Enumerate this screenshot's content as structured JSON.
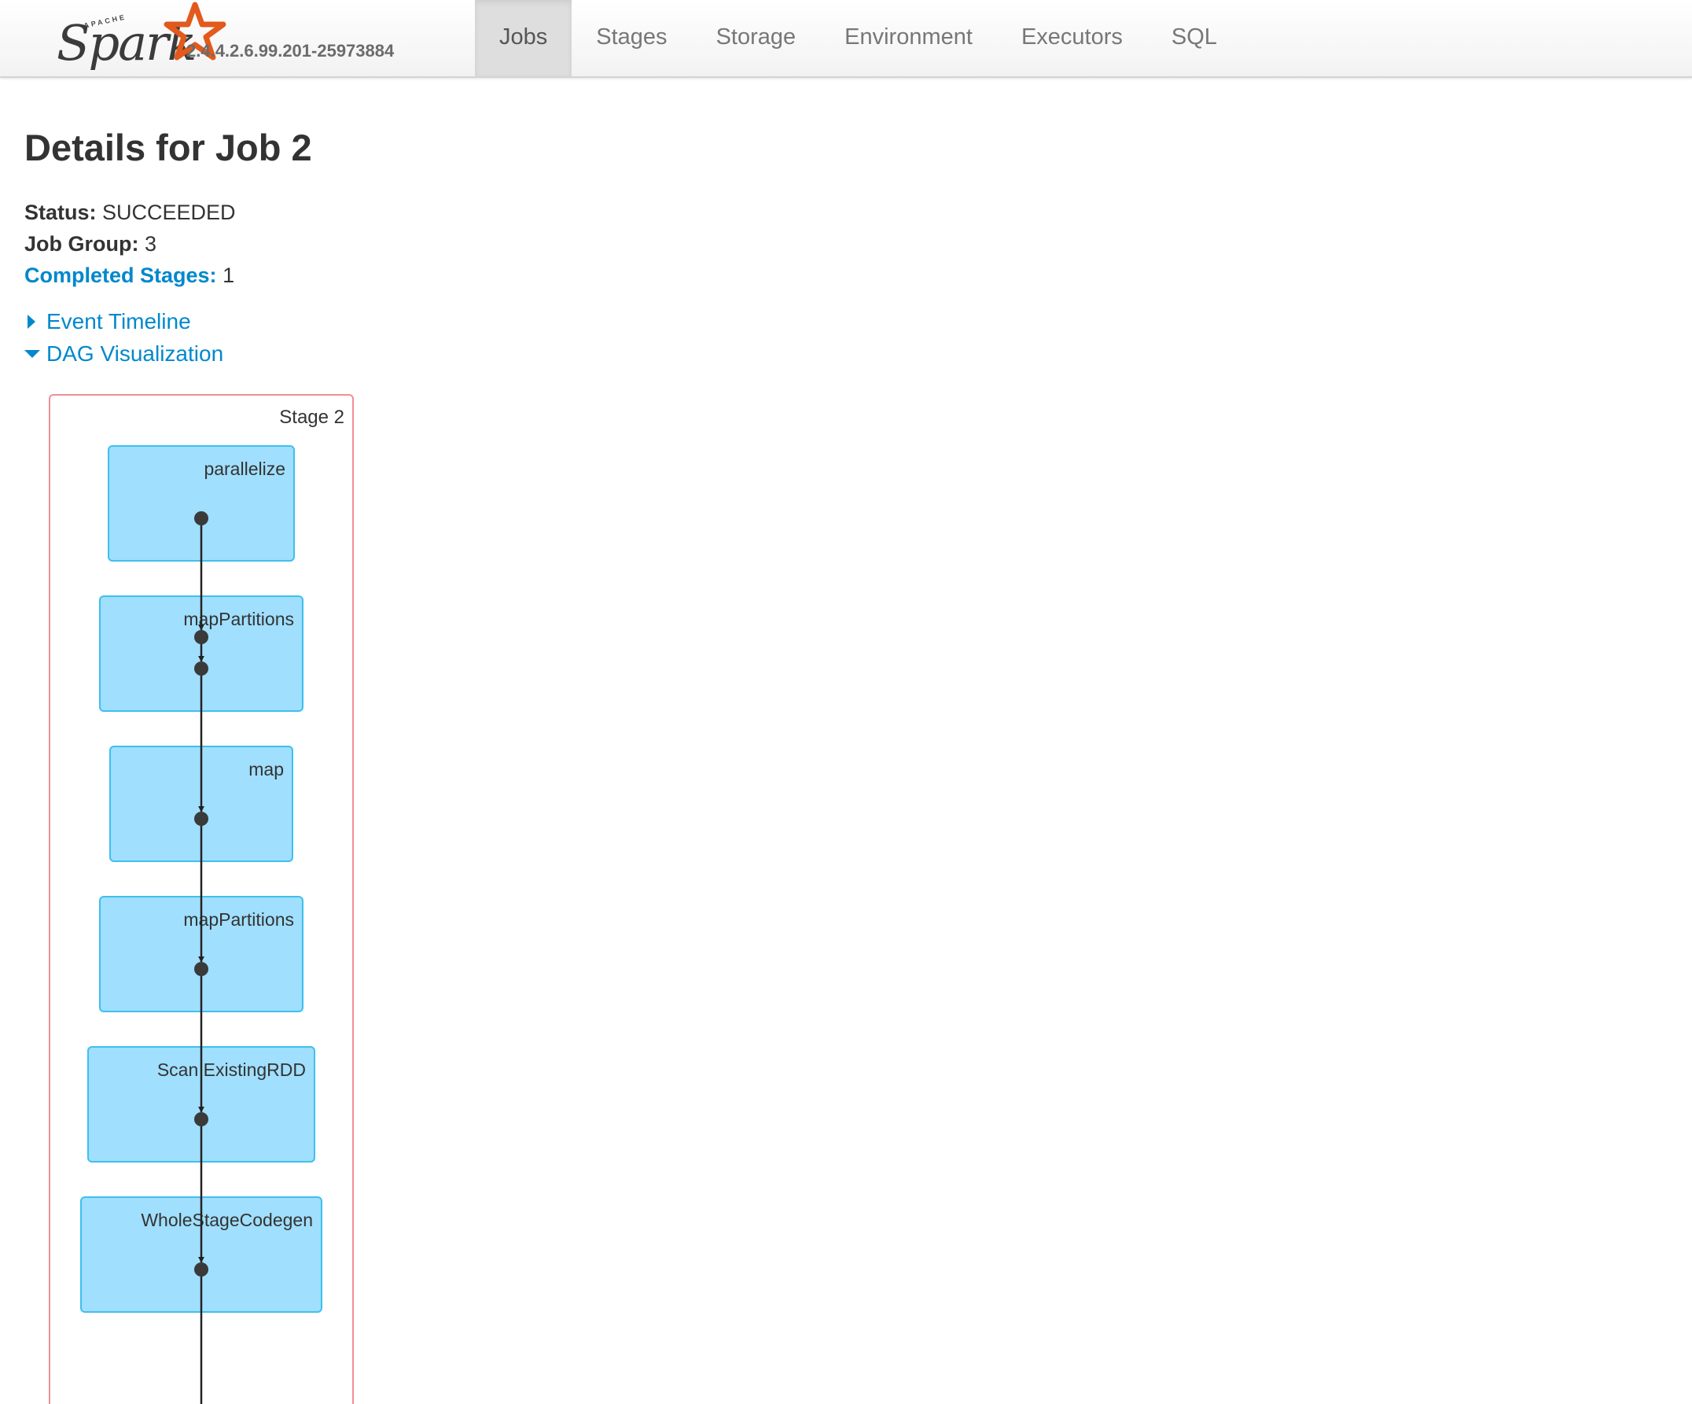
{
  "header": {
    "brand_apache": "APACHE",
    "brand_name": "Spark",
    "version": "2.4.4.2.6.99.201-25973884",
    "tabs": [
      {
        "label": "Jobs",
        "active": true
      },
      {
        "label": "Stages",
        "active": false
      },
      {
        "label": "Storage",
        "active": false
      },
      {
        "label": "Environment",
        "active": false
      },
      {
        "label": "Executors",
        "active": false
      },
      {
        "label": "SQL",
        "active": false
      }
    ]
  },
  "page": {
    "title": "Details for Job 2",
    "status_label": "Status:",
    "status_value": "SUCCEEDED",
    "job_group_label": "Job Group:",
    "job_group_value": "3",
    "completed_stages_label": "Completed Stages:",
    "completed_stages_value": "1",
    "event_timeline": "Event Timeline",
    "dag_visualization": "DAG Visualization"
  },
  "dag": {
    "stage_label": "Stage 2",
    "nodes": [
      "parallelize",
      "mapPartitions",
      "map",
      "mapPartitions",
      "Scan ExistingRDD",
      "WholeStageCodegen"
    ]
  },
  "colors": {
    "accent": "#0088cc",
    "node_fill": "#a0dffd",
    "node_border": "#3ec0ee",
    "stage_border": "#ef8f98",
    "spark_orange": "#e25a1c"
  }
}
